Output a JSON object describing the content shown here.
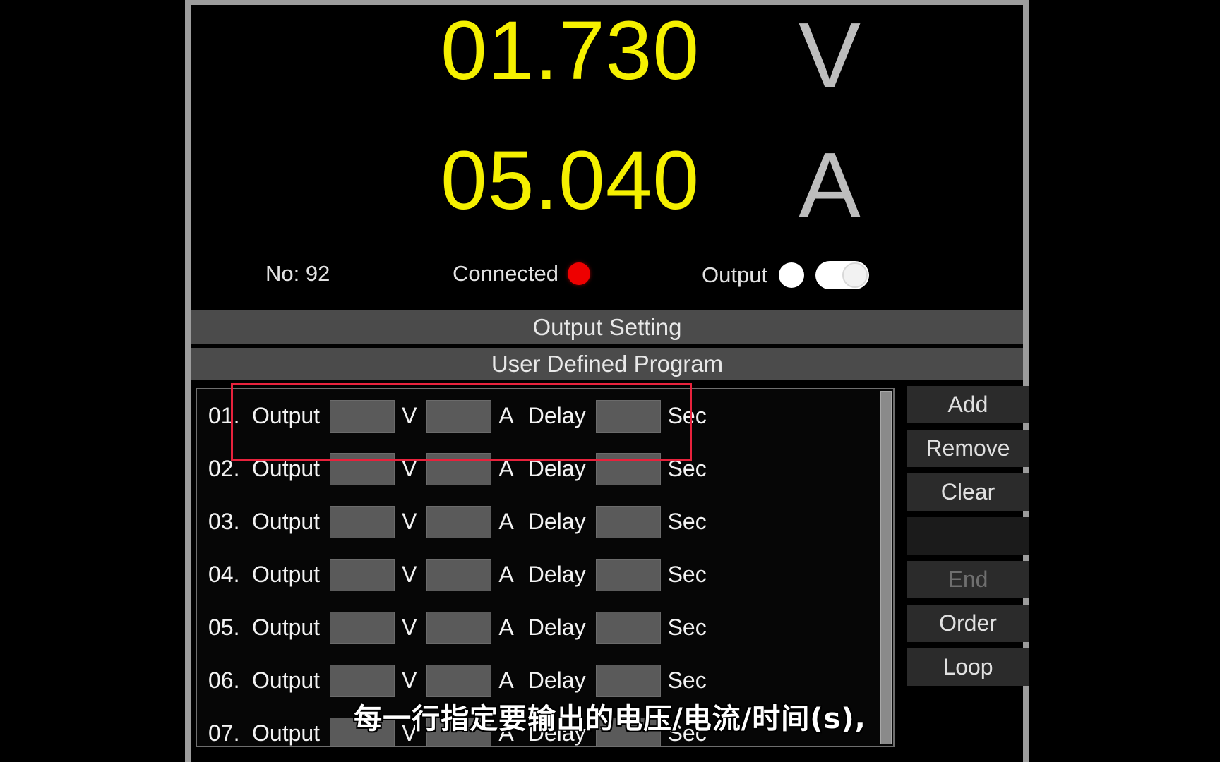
{
  "device": {
    "voltage": {
      "value": "01.730",
      "unit": "V"
    },
    "current": {
      "value": "05.040",
      "unit": "A"
    },
    "status": {
      "number_label": "No: 92",
      "connection_label": "Connected",
      "connection_led_color": "#ee0000",
      "output_label": "Output",
      "output_lamp_state": "on",
      "output_toggle_state": "on"
    }
  },
  "sections": {
    "output_setting_title": "Output Setting",
    "user_defined_program_title": "User Defined Program"
  },
  "program": {
    "row_labels": {
      "output": "Output",
      "volt_unit": "V",
      "amp_unit": "A",
      "delay": "Delay",
      "sec_unit": "Sec"
    },
    "rows": [
      {
        "index": "01.",
        "volts": "",
        "amps": "",
        "delay": ""
      },
      {
        "index": "02.",
        "volts": "",
        "amps": "",
        "delay": ""
      },
      {
        "index": "03.",
        "volts": "",
        "amps": "",
        "delay": ""
      },
      {
        "index": "04.",
        "volts": "",
        "amps": "",
        "delay": ""
      },
      {
        "index": "05.",
        "volts": "",
        "amps": "",
        "delay": ""
      },
      {
        "index": "06.",
        "volts": "",
        "amps": "",
        "delay": ""
      },
      {
        "index": "07.",
        "volts": "",
        "amps": "",
        "delay": ""
      }
    ]
  },
  "buttons": [
    {
      "label": "Add",
      "state": "enabled"
    },
    {
      "label": "Remove",
      "state": "enabled"
    },
    {
      "label": "Clear",
      "state": "enabled"
    },
    {
      "label": "",
      "state": "blank"
    },
    {
      "label": "End",
      "state": "disabled"
    },
    {
      "label": "Order",
      "state": "enabled"
    },
    {
      "label": "Loop",
      "state": "enabled"
    }
  ],
  "subtitle": {
    "text": "每一行指定要输出的电压/电流/时间(s),"
  },
  "annotation": {
    "type": "red-rectangle",
    "color": "#e8223c",
    "targets": "program-row-01"
  },
  "colors": {
    "meter_yellow": "#f5f000",
    "panel_border": "#9c9c9c",
    "section_header_bg": "#4b4b4b",
    "button_bg": "#2b2b2b",
    "field_bg": "#5a5a5a"
  }
}
